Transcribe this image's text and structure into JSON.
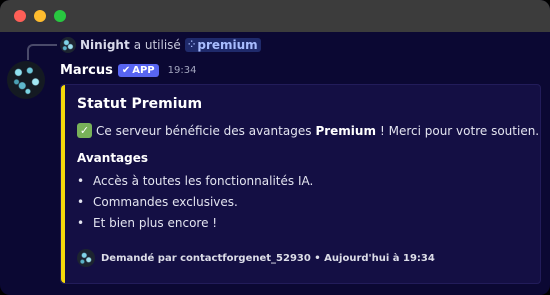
{
  "reply": {
    "user": "Ninight",
    "action": "a utilisé",
    "command": "premium"
  },
  "message": {
    "author": "Marcus",
    "badge": "APP",
    "time": "19:34"
  },
  "embed": {
    "accent_color": "#f5d90a",
    "title": "Statut Premium",
    "description_prefix": "Ce serveur bénéficie des avantages",
    "description_bold": "Premium",
    "description_suffix": "! Merci pour votre soutien.",
    "field_name": "Avantages",
    "field_items": [
      "Accès à toutes les fonctionnalités IA.",
      "Commandes exclusives.",
      "Et bien plus encore !"
    ],
    "footer": "Demandé par contactforgenet_52930 • Aujourd'hui à 19:34"
  },
  "icons": {
    "check": "white-check-mark",
    "command": "slash-command-icon",
    "badge": "verified-check"
  }
}
